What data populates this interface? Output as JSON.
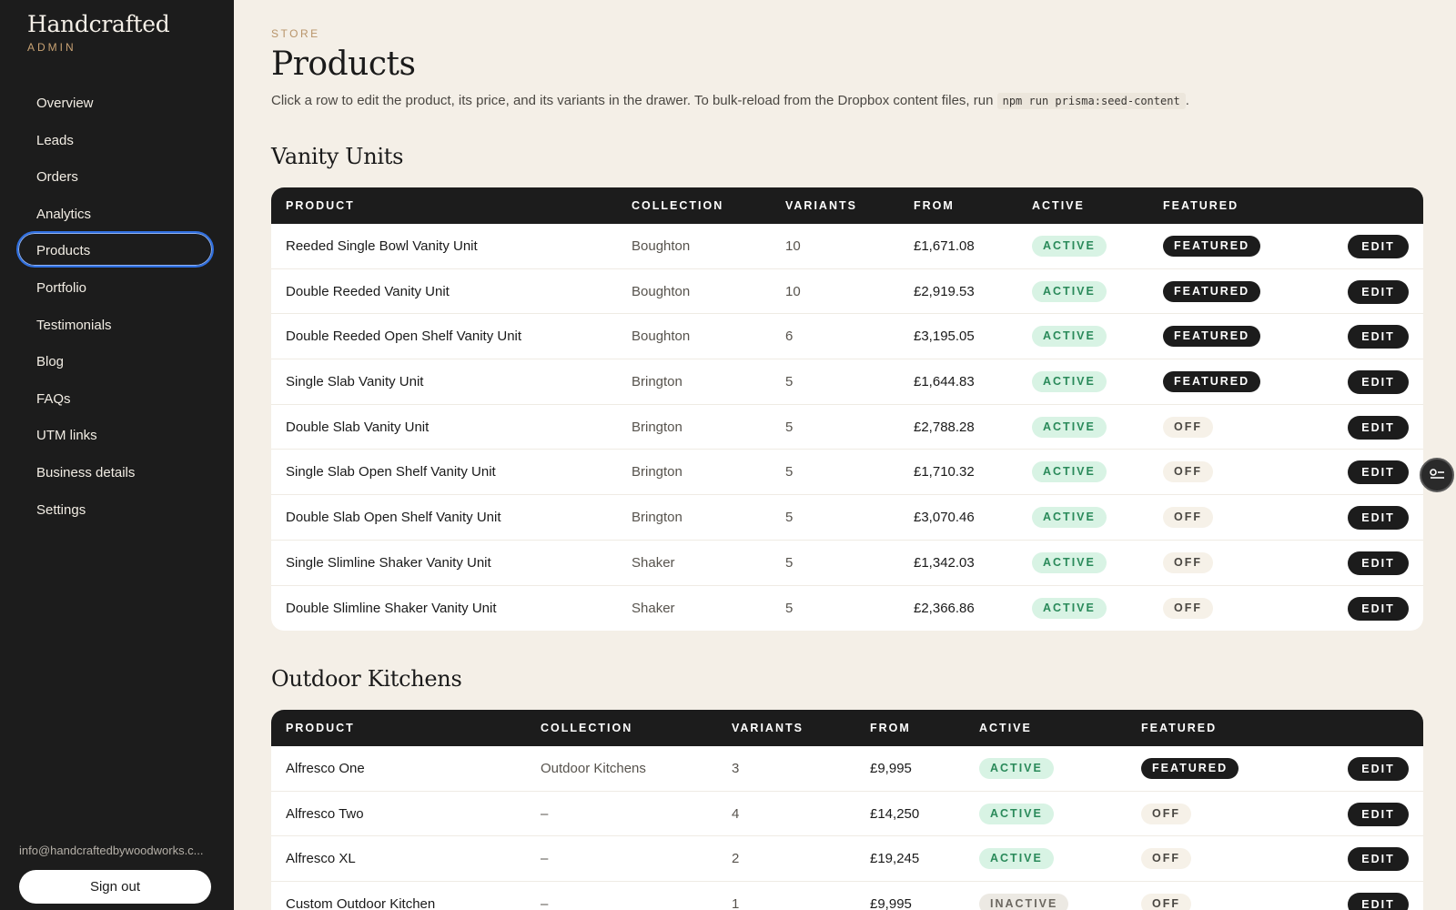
{
  "brand": {
    "name": "Handcrafted",
    "sub": "ADMIN"
  },
  "nav": [
    {
      "label": "Overview",
      "key": "overview"
    },
    {
      "label": "Leads",
      "key": "leads"
    },
    {
      "label": "Orders",
      "key": "orders"
    },
    {
      "label": "Analytics",
      "key": "analytics"
    },
    {
      "label": "Products",
      "key": "products",
      "active": true
    },
    {
      "label": "Portfolio",
      "key": "portfolio"
    },
    {
      "label": "Testimonials",
      "key": "testimonials"
    },
    {
      "label": "Blog",
      "key": "blog"
    },
    {
      "label": "FAQs",
      "key": "faqs"
    },
    {
      "label": "UTM links",
      "key": "utm-links"
    },
    {
      "label": "Business details",
      "key": "business-details"
    },
    {
      "label": "Settings",
      "key": "settings"
    }
  ],
  "account": {
    "email": "info@handcraftedbywoodworks.c...",
    "signout_label": "Sign out"
  },
  "page": {
    "eyebrow": "STORE",
    "title": "Products",
    "desc_before": "Click a row to edit the product, its price, and its variants in the drawer. To bulk-reload from the Dropbox content files, run ",
    "desc_code": "npm run prisma:seed-content",
    "desc_after": "."
  },
  "columns": {
    "product": "PRODUCT",
    "collection": "COLLECTION",
    "variants": "VARIANTS",
    "from": "FROM",
    "active": "ACTIVE",
    "featured": "FEATURED"
  },
  "edit_label": "EDIT",
  "sections": [
    {
      "title": "Vanity Units",
      "rows": [
        {
          "name": "Reeded Single Bowl Vanity Unit",
          "collection": "Boughton",
          "variants": "10",
          "from": "£1,671.08",
          "active": "ACTIVE",
          "featured": "FEATURED"
        },
        {
          "name": "Double Reeded Vanity Unit",
          "collection": "Boughton",
          "variants": "10",
          "from": "£2,919.53",
          "active": "ACTIVE",
          "featured": "FEATURED"
        },
        {
          "name": "Double Reeded Open Shelf Vanity Unit",
          "collection": "Boughton",
          "variants": "6",
          "from": "£3,195.05",
          "active": "ACTIVE",
          "featured": "FEATURED"
        },
        {
          "name": "Single Slab Vanity Unit",
          "collection": "Brington",
          "variants": "5",
          "from": "£1,644.83",
          "active": "ACTIVE",
          "featured": "FEATURED"
        },
        {
          "name": "Double Slab Vanity Unit",
          "collection": "Brington",
          "variants": "5",
          "from": "£2,788.28",
          "active": "ACTIVE",
          "featured": "OFF"
        },
        {
          "name": "Single Slab Open Shelf Vanity Unit",
          "collection": "Brington",
          "variants": "5",
          "from": "£1,710.32",
          "active": "ACTIVE",
          "featured": "OFF"
        },
        {
          "name": "Double Slab Open Shelf Vanity Unit",
          "collection": "Brington",
          "variants": "5",
          "from": "£3,070.46",
          "active": "ACTIVE",
          "featured": "OFF"
        },
        {
          "name": "Single Slimline Shaker Vanity Unit",
          "collection": "Shaker",
          "variants": "5",
          "from": "£1,342.03",
          "active": "ACTIVE",
          "featured": "OFF"
        },
        {
          "name": "Double Slimline Shaker Vanity Unit",
          "collection": "Shaker",
          "variants": "5",
          "from": "£2,366.86",
          "active": "ACTIVE",
          "featured": "OFF"
        }
      ]
    },
    {
      "title": "Outdoor Kitchens",
      "rows": [
        {
          "name": "Alfresco One",
          "collection": "Outdoor Kitchens",
          "variants": "3",
          "from": "£9,995",
          "active": "ACTIVE",
          "featured": "FEATURED"
        },
        {
          "name": "Alfresco Two",
          "collection": "–",
          "variants": "4",
          "from": "£14,250",
          "active": "ACTIVE",
          "featured": "OFF"
        },
        {
          "name": "Alfresco XL",
          "collection": "–",
          "variants": "2",
          "from": "£19,245",
          "active": "ACTIVE",
          "featured": "OFF"
        },
        {
          "name": "Custom Outdoor Kitchen",
          "collection": "–",
          "variants": "1",
          "from": "£9,995",
          "active": "INACTIVE",
          "featured": "OFF"
        }
      ]
    }
  ],
  "colors": {
    "accent": "#c8a273",
    "sidebar": "#1c1c1c",
    "background": "#f4efe7",
    "active_pill": "#d8f3e4",
    "focus_ring": "#2f6fe0"
  },
  "floating_button_icon": "filter-list-icon"
}
